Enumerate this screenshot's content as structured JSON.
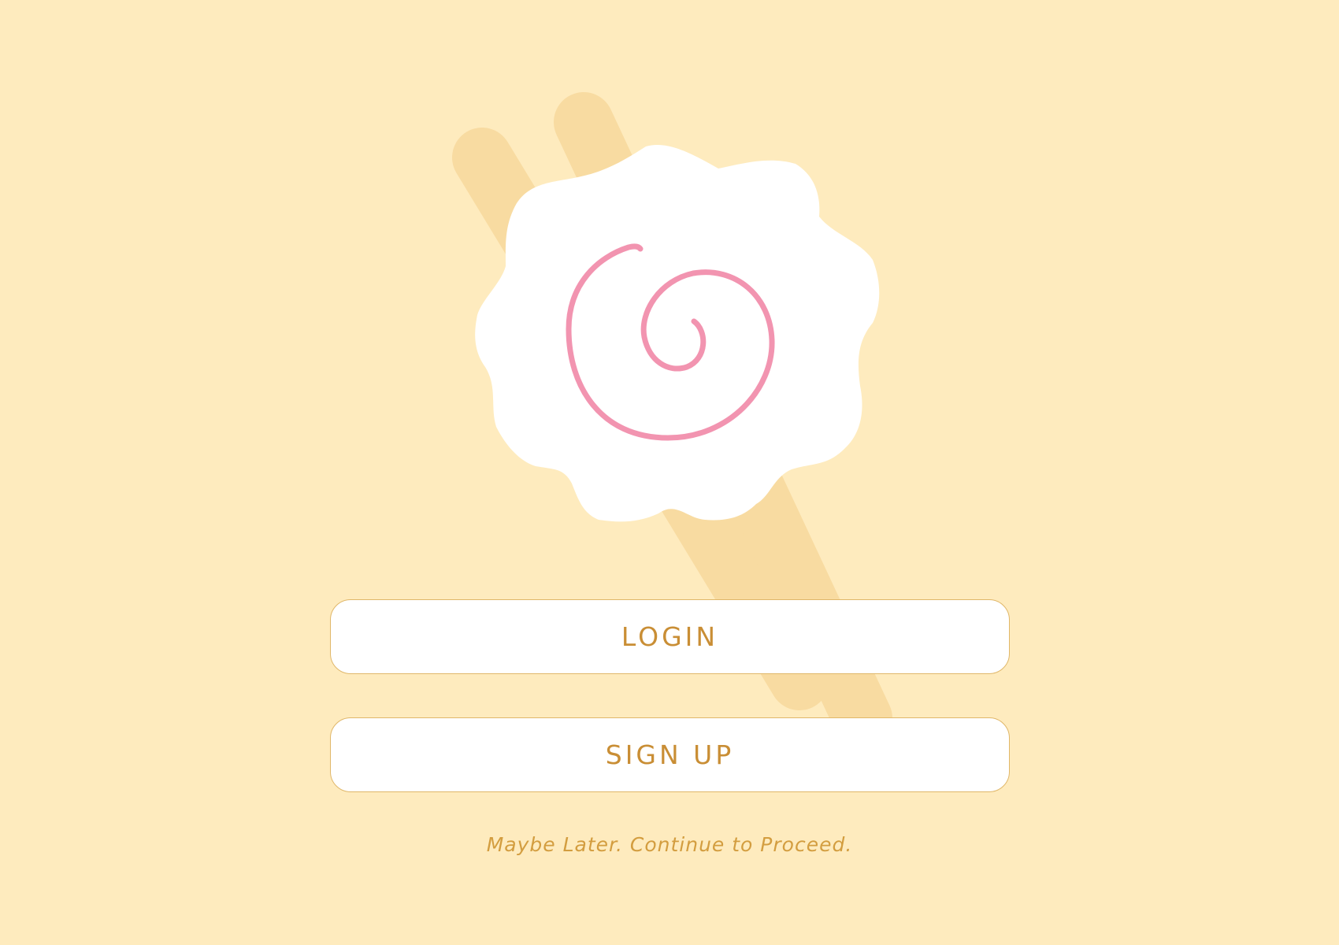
{
  "colors": {
    "background": "#FEEBBE",
    "chopsticks": "#F8DBA1",
    "naruto_fill": "#FFFFFF",
    "naruto_swirl": "#F294B0",
    "button_text": "#C98E35",
    "button_border": "#E0B769",
    "link_text": "#D39D3F"
  },
  "illustration": {
    "icon": "naruto-fishcake-with-chopsticks-icon"
  },
  "actions": {
    "login_label": "LOGIN",
    "signup_label": "SIGN UP",
    "skip_label": "Maybe Later. Continue to Proceed."
  }
}
